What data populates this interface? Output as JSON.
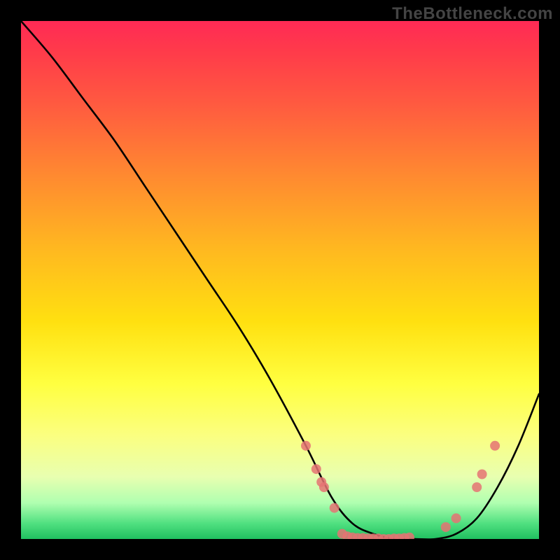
{
  "watermark": "TheBottleneck.com",
  "chart_data": {
    "type": "line",
    "title": "",
    "xlabel": "",
    "ylabel": "",
    "xlim": [
      0,
      100
    ],
    "ylim": [
      0,
      100
    ],
    "grid": false,
    "series": [
      {
        "name": "curve",
        "x": [
          0,
          6,
          12,
          18,
          24,
          30,
          36,
          42,
          48,
          55,
          60,
          64,
          68,
          72,
          76,
          80,
          84,
          88,
          92,
          96,
          100
        ],
        "values": [
          100,
          93,
          85,
          77,
          68,
          59,
          50,
          41,
          31,
          18,
          8,
          3,
          1,
          0,
          0,
          0,
          1,
          4,
          10,
          18,
          28
        ]
      }
    ],
    "markers": [
      {
        "x": 55.0,
        "y": 18.0
      },
      {
        "x": 57.0,
        "y": 13.5
      },
      {
        "x": 58.0,
        "y": 11.0
      },
      {
        "x": 58.5,
        "y": 10.0
      },
      {
        "x": 60.5,
        "y": 6.0
      },
      {
        "x": 62.0,
        "y": 1.0
      },
      {
        "x": 63.0,
        "y": 0.5
      },
      {
        "x": 64.0,
        "y": 0.3
      },
      {
        "x": 65.0,
        "y": 0.2
      },
      {
        "x": 66.0,
        "y": 0.2
      },
      {
        "x": 67.0,
        "y": 0.1
      },
      {
        "x": 68.0,
        "y": 0.1
      },
      {
        "x": 69.0,
        "y": 0.1
      },
      {
        "x": 70.0,
        "y": 0.0
      },
      {
        "x": 71.0,
        "y": 0.0
      },
      {
        "x": 72.0,
        "y": 0.1
      },
      {
        "x": 73.0,
        "y": 0.1
      },
      {
        "x": 74.0,
        "y": 0.2
      },
      {
        "x": 75.0,
        "y": 0.3
      },
      {
        "x": 82.0,
        "y": 2.3
      },
      {
        "x": 84.0,
        "y": 4.0
      },
      {
        "x": 88.0,
        "y": 10.0
      },
      {
        "x": 89.0,
        "y": 12.5
      },
      {
        "x": 91.5,
        "y": 18.0
      }
    ]
  }
}
